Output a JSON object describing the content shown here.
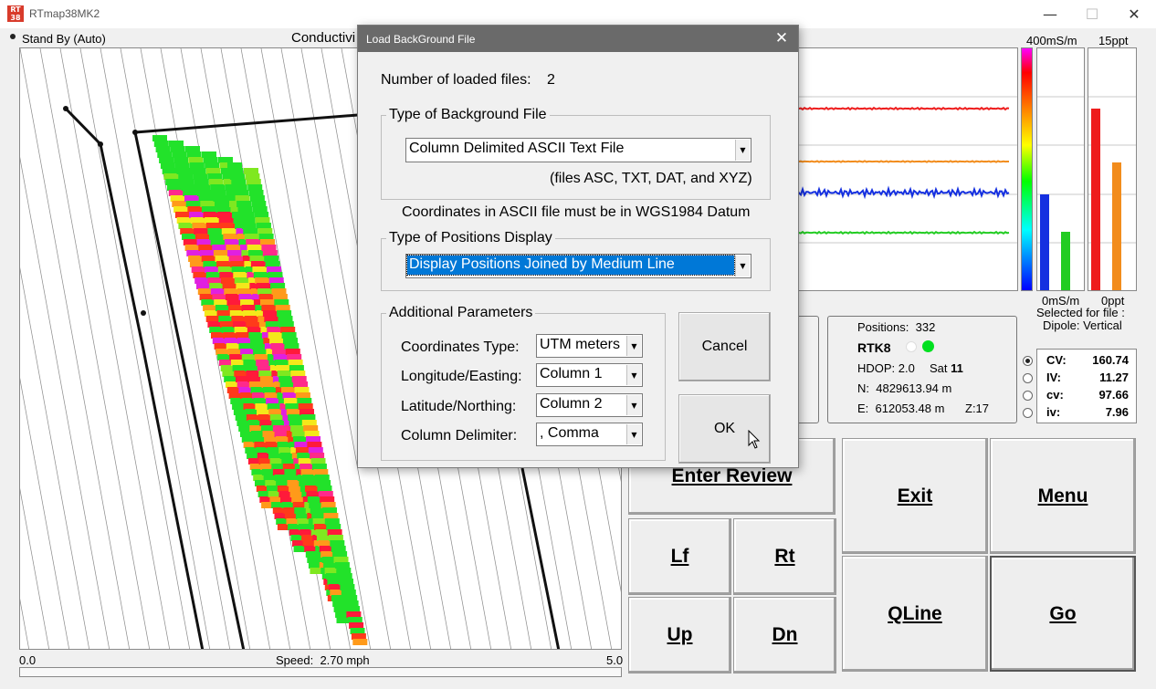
{
  "window": {
    "title": "RTmap38MK2",
    "icon_text": "RT 38",
    "minimize_label": "—",
    "maximize_label": "☐",
    "close_label": "✕"
  },
  "status": {
    "mode": "Stand By (Auto)",
    "map_title": "Conductivi"
  },
  "scale": {
    "cond_top": "400mS/m",
    "cond_bottom": "0mS/m",
    "salinity_top": "15ppt",
    "salinity_bottom": "0ppt",
    "selected_for_file": "Selected for file :",
    "dipole": "Dipole: Vertical"
  },
  "speed": {
    "min": "0.0",
    "max": "5.0",
    "label": "Speed:",
    "value": "2.70 mph"
  },
  "gps": {
    "positions_label": "Positions:",
    "positions": "332",
    "rtk": "RTK8",
    "hdop_label": "HDOP:",
    "hdop": "2.0",
    "sat_label": "Sat",
    "sat": "11",
    "n_label": "N:",
    "northing": "4829613.94 m",
    "e_label": "E:",
    "easting": "612053.48 m",
    "zone": "Z:17"
  },
  "readings": [
    {
      "label": "CV:",
      "value": "160.74",
      "selected": true
    },
    {
      "label": "IV:",
      "value": "11.27",
      "selected": false
    },
    {
      "label": "cv:",
      "value": "97.66",
      "selected": false
    },
    {
      "label": "iv:",
      "value": "7.96",
      "selected": false
    }
  ],
  "buttons": {
    "enter_review": "Enter Review",
    "exit": "Exit",
    "menu": "Menu",
    "lf": "Lf",
    "rt": "Rt",
    "qline": "QLine",
    "go": "Go",
    "up": "Up",
    "dn": "Dn"
  },
  "colors": {
    "trace1": "#ee1c1c",
    "trace2": "#f28c1c",
    "trace3": "#1530e0",
    "trace4": "#22cc22",
    "dialog_title_bg": "#6a6a6a",
    "selection": "#0078d7"
  },
  "dialog": {
    "title": "Load BackGround File",
    "close_label": "✕",
    "loaded_label": "Number of loaded files:",
    "loaded_count": "2",
    "bg_type_legend": "Type of Background File",
    "bg_type_value": "Column Delimited ASCII Text File",
    "bg_type_hint": "(files ASC, TXT, DAT, and XYZ)",
    "datum_note": "Coordinates in ASCII file must be in WGS1984 Datum",
    "pos_display_legend": "Type of Positions Display",
    "pos_display_value": "Display Positions Joined by Medium Line",
    "params_legend": "Additional Parameters",
    "coord_type_label": "Coordinates Type:",
    "coord_type_value": "UTM meters",
    "lon_label": "Longitude/Easting:",
    "lon_value": "Column 1",
    "lat_label": "Latitude/Northing:",
    "lat_value": "Column 2",
    "delim_label": "Column Delimiter:",
    "delim_value": ", Comma",
    "cancel_label": "Cancel",
    "ok_label": "OK"
  }
}
